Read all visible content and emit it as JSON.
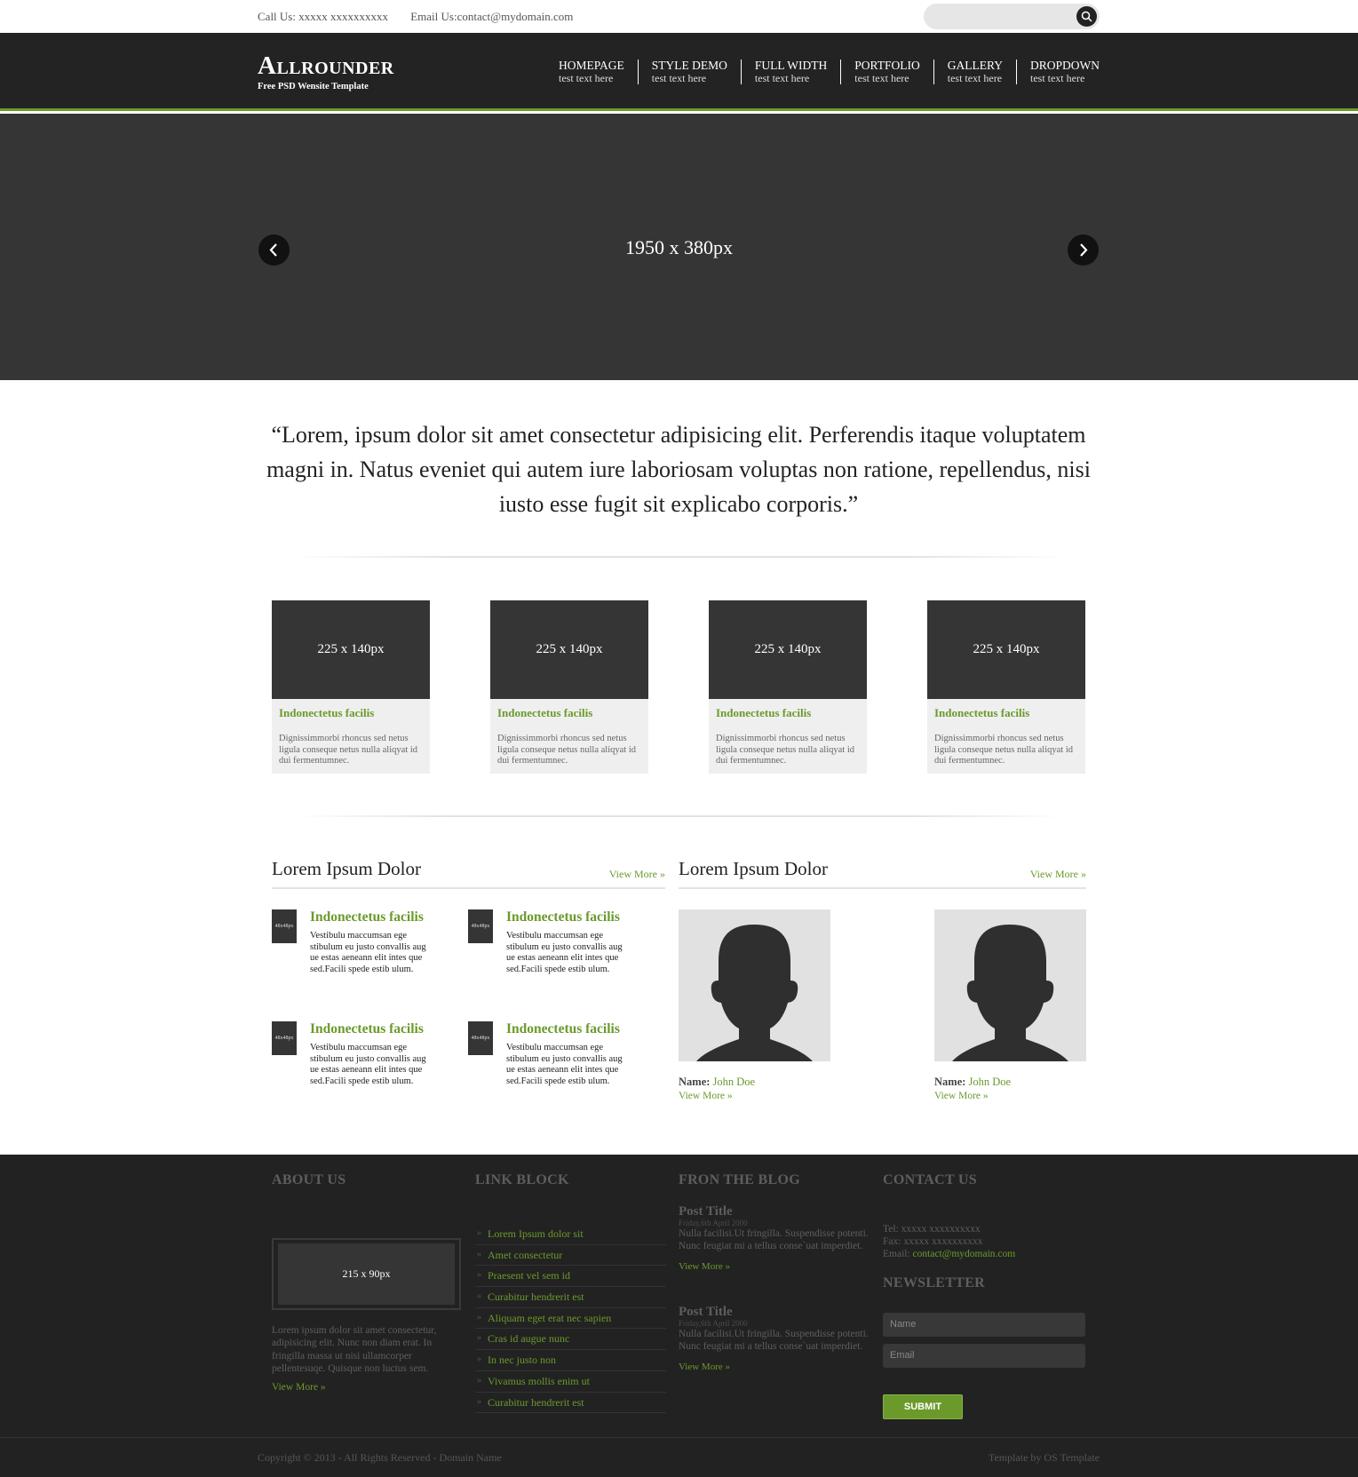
{
  "topbar": {
    "call": "Call Us: xxxxx xxxxxxxxxx",
    "email": "Email Us:contact@mydomain.com"
  },
  "logo": {
    "title": "Allrounder",
    "subtitle": "Free PSD Wensite Template"
  },
  "nav": [
    {
      "label": "HOMEPAGE",
      "sub": "test text here"
    },
    {
      "label": "STYLE DEMO",
      "sub": "test text here"
    },
    {
      "label": "FULL WIDTH",
      "sub": "test text here"
    },
    {
      "label": "PORTFOLIO",
      "sub": "test text here"
    },
    {
      "label": "GALLERY",
      "sub": "test text here"
    },
    {
      "label": "DROPDOWN",
      "sub": "test text here"
    }
  ],
  "slider": {
    "placeholder": "1950 x 380px"
  },
  "quote": "“Lorem, ipsum dolor sit amet consectetur adipisicing elit. Perferendis itaque voluptatem magni in. Natus eveniet qui autem iure laboriosam voluptas non ratione, repellendus, nisi iusto esse fugit sit explicabo corporis.”",
  "features": [
    {
      "thumb": "225 x 140px",
      "title": "Indonectetus facilis",
      "text": "Dignissimmorbi rhoncus sed netus ligula conseque netus nulla aliqyat id dui fermentumnec."
    },
    {
      "thumb": "225 x 140px",
      "title": "Indonectetus facilis",
      "text": "Dignissimmorbi rhoncus sed netus ligula conseque netus nulla aliqyat id dui fermentumnec."
    },
    {
      "thumb": "225 x 140px",
      "title": "Indonectetus facilis",
      "text": "Dignissimmorbi rhoncus sed netus ligula conseque netus nulla aliqyat id dui fermentumnec."
    },
    {
      "thumb": "225 x 140px",
      "title": "Indonectetus facilis",
      "text": "Dignissimmorbi rhoncus sed netus ligula conseque netus nulla aliqyat id dui fermentumnec."
    }
  ],
  "left_section": {
    "heading": "Lorem Ipsum Dolor",
    "more": "View More »",
    "items": [
      {
        "thumb": "48x48px",
        "title": "Indonectetus facilis",
        "text": "Vestibulu maccumsan ege stibulum eu justo convallis aug ue estas aeneann elit intes que sed.Facili spede estib ulum."
      },
      {
        "thumb": "48x48px",
        "title": "Indonectetus facilis",
        "text": "Vestibulu maccumsan ege stibulum eu justo convallis aug ue estas aeneann elit intes que sed.Facili spede estib ulum."
      },
      {
        "thumb": "48x48px",
        "title": "Indonectetus facilis",
        "text": "Vestibulu maccumsan ege stibulum eu justo convallis aug ue estas aeneann elit intes que sed.Facili spede estib ulum."
      },
      {
        "thumb": "48x48px",
        "title": "Indonectetus facilis",
        "text": "Vestibulu maccumsan ege stibulum eu justo convallis aug ue estas aeneann elit intes que sed.Facili spede estib ulum."
      }
    ]
  },
  "right_section": {
    "heading": "Lorem Ipsum Dolor",
    "more": "View More »",
    "people": [
      {
        "name_label": "Name:",
        "name": "John Doe",
        "more": "View More »"
      },
      {
        "name_label": "Name:",
        "name": "John Doe",
        "more": "View More »"
      }
    ]
  },
  "footer": {
    "about": {
      "heading": "ABOUT US",
      "image": "215 x 90px",
      "text": "Lorem ipsum dolor sit amet consectetur, adipisicing elit. Nunc non diam erat. In fringilla massa ut nisi ullamcorper pellentesuqe. Quisque non luctus sem.",
      "more": "View More »"
    },
    "links": {
      "heading": "LINK BLOCK",
      "items": [
        "Lorem Ipsum dolor sit",
        "Amet consectetur",
        "Praesent vel sem id",
        "Curabitur hendrerit est",
        "Aliquam eget erat nec sapien",
        "Cras id augue nunc",
        "In nec justo non",
        "Vivamus mollis enim ut",
        "Curabitur hendrerit est"
      ]
    },
    "blog": {
      "heading": "FRON THE BLOG",
      "posts": [
        {
          "title": "Post Title",
          "date": "Friday,6th April 2000",
          "text": "Nulla facilisi.Ut fringilla. Suspendisse potenti. Nunc feugiat mi a tellus conse`uat imperdiet.",
          "more": "View More »"
        },
        {
          "title": "Post Title",
          "date": "Friday,6th April 2000",
          "text": "Nulla facilisi.Ut fringilla. Suspendisse potenti. Nunc feugiat mi a tellus conse`uat imperdiet.",
          "more": "View More »"
        }
      ]
    },
    "contact": {
      "heading": "CONTACT US",
      "tel": "Tel: xxxxx xxxxxxxxxx",
      "fax": "Fax: xxxxx xxxxxxxxxx",
      "email_label": "Email:",
      "email": "contact@mydomain.com",
      "newsletter_heading": "NEWSLETTER",
      "name_placeholder": "Name",
      "email_placeholder": "Email",
      "submit": "SUBMIT"
    }
  },
  "bottom": {
    "copyright": "Copyright © 2013 - All Rights Reserved - Domain Name",
    "credit": "Template by OS Template"
  },
  "colors": {
    "accent": "#6b9a2b",
    "dark": "#232323",
    "placeholder": "#353535"
  }
}
